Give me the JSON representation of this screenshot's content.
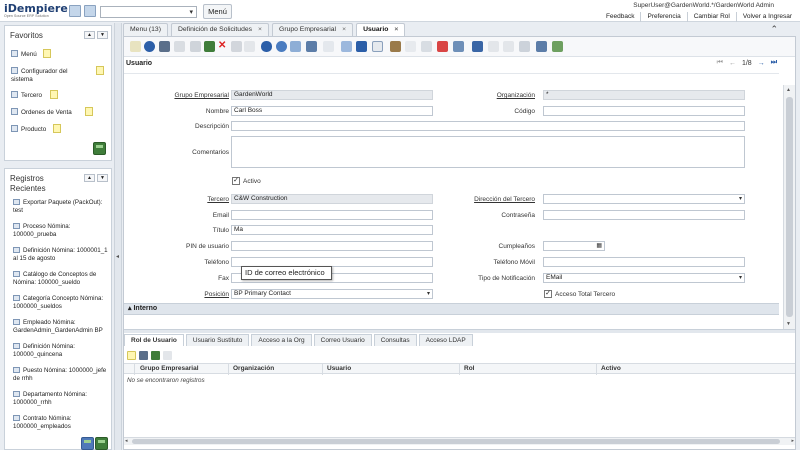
{
  "header": {
    "logo_name": "iDempiere",
    "logo_tag": "Open Source ERP Solution",
    "menu_button": "Menú",
    "user_line": "SuperUser@GardenWorld.*/GardenWorld Admin",
    "links": [
      "Feedback",
      "Preferencia",
      "Cambiar Rol",
      "Volver a Ingresar"
    ]
  },
  "favorites": {
    "title": "Favoritos",
    "items": [
      "Menú",
      "Configurador del sistema",
      "Tercero",
      "Ordenes de Venta",
      "Producto"
    ]
  },
  "recent": {
    "title": "Registros Recientes",
    "items": [
      "Exportar Paquete (PackOut): test",
      "Proceso Nómina: 100000_prueba",
      "Definición Nómina: 1000001_1 al 15 de agosto",
      "Catálogo de Conceptos de Nómina: 100000_sueldo",
      "Categoría Concepto Nómina: 1000000_sueldos",
      "Empleado Nómina: GardenAdmin_GardenAdmin BP",
      "Definición Nómina: 100000_quincena",
      "Puesto Nómina: 1000000_jefe de rrhh",
      "Departamento Nómina: 1000000_rrhh",
      "Contrato Nómina: 1000000_empleados"
    ]
  },
  "tabs": [
    {
      "label": "Menu (13)",
      "closable": false
    },
    {
      "label": "Definición de Solicitudes",
      "closable": true
    },
    {
      "label": "Grupo Empresarial",
      "closable": true
    },
    {
      "label": "Usuario",
      "closable": true
    }
  ],
  "window": {
    "breadcrumb": "Usuario",
    "record_nav": "1/8",
    "section_interno": "Interno",
    "tooltip": "ID de correo electrónico",
    "fields": {
      "grupo_empresarial": {
        "label": "Grupo Empresarial",
        "value": "GardenWorld"
      },
      "organizacion": {
        "label": "Organización",
        "value": "*"
      },
      "nombre": {
        "label": "Nombre",
        "value": "Carl Boss"
      },
      "codigo": {
        "label": "Código",
        "value": ""
      },
      "descripcion": {
        "label": "Descripción",
        "value": ""
      },
      "comentarios": {
        "label": "Comentarios",
        "value": ""
      },
      "activo": {
        "label": "Activo",
        "checked": true
      },
      "tercero": {
        "label": "Tercero",
        "value": "C&W Construction"
      },
      "direccion_tercero": {
        "label": "Dirección del Tercero",
        "value": ""
      },
      "email": {
        "label": "Email",
        "value": ""
      },
      "contrasena": {
        "label": "Contraseña",
        "value": ""
      },
      "titulo": {
        "label": "Título",
        "value": "Ma"
      },
      "pin": {
        "label": "PIN de usuario",
        "value": ""
      },
      "cumpleanos": {
        "label": "Cumpleaños",
        "value": ""
      },
      "telefono": {
        "label": "Teléfono",
        "value": ""
      },
      "telefono_movil": {
        "label": "Teléfono Móvil",
        "value": ""
      },
      "fax": {
        "label": "Fax",
        "value": ""
      },
      "tipo_notificacion": {
        "label": "Tipo de Notificación",
        "value": "EMail"
      },
      "posicion": {
        "label": "Posición",
        "value": "BP Primary Contact"
      },
      "acceso_total": {
        "label": "Acceso Total Tercero",
        "checked": true
      }
    }
  },
  "subtabs": [
    "Rol de Usuario",
    "Usuario Sustituto",
    "Acceso a la Org",
    "Correo Usuario",
    "Consultas",
    "Acceso LDAP"
  ],
  "grid": {
    "columns": [
      "Grupo Empresarial",
      "Organización",
      "Usuario",
      "Rol",
      "Activo"
    ],
    "empty_message": "No se encontraron registros"
  },
  "colors": {
    "accent": "#2b5ea8",
    "brand": "#1f3f73",
    "tooltip_border": "#555555"
  }
}
